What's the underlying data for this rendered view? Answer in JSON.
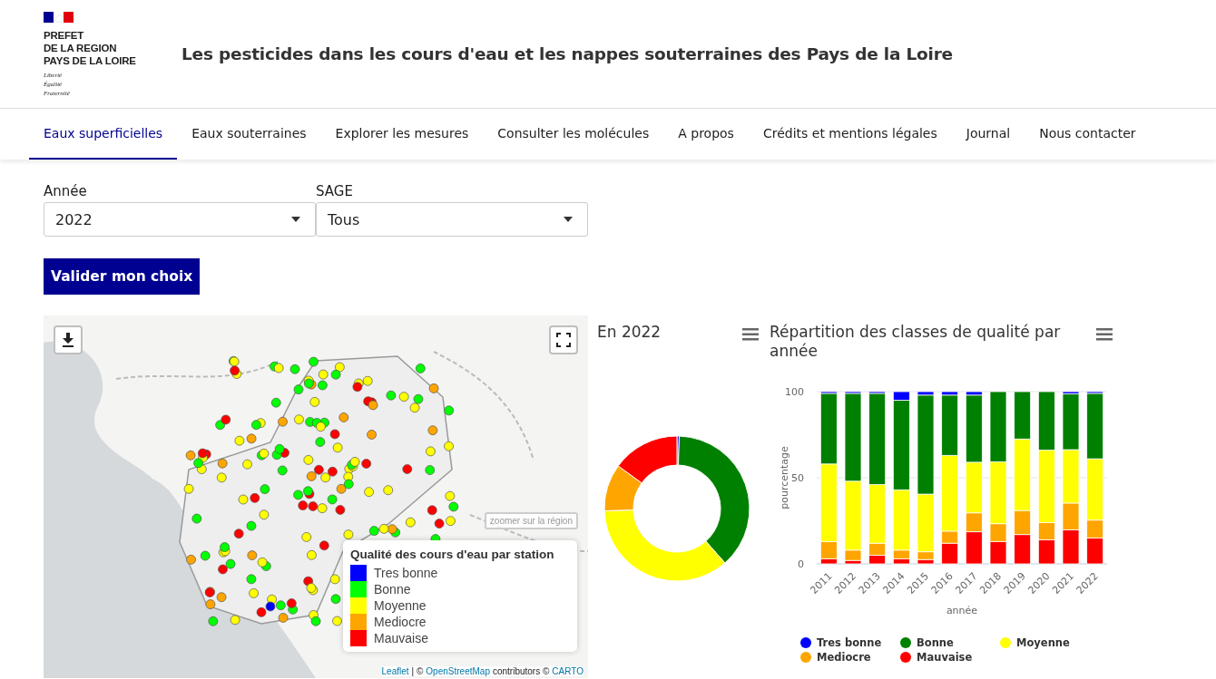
{
  "header": {
    "logo_lines": [
      "PREFET",
      "DE LA REGION",
      "PAYS DE LA LOIRE"
    ],
    "motto": [
      "Liberté",
      "Égalité",
      "Fraternité"
    ],
    "title": "Les pesticides dans les cours d'eau et les nappes souterraines des Pays de la Loire"
  },
  "nav": [
    {
      "label": "Eaux superficielles",
      "selected": true
    },
    {
      "label": "Eaux souterraines",
      "selected": false
    },
    {
      "label": "Explorer les mesures",
      "selected": false
    },
    {
      "label": "Consulter les molécules",
      "selected": false
    },
    {
      "label": "A propos",
      "selected": false
    },
    {
      "label": "Crédits et mentions légales",
      "selected": false
    },
    {
      "label": "Journal",
      "selected": false
    },
    {
      "label": "Nous contacter",
      "selected": false
    }
  ],
  "filters": [
    {
      "label": "Année",
      "value": "2022"
    },
    {
      "label": "SAGE",
      "value": "Tous"
    }
  ],
  "submit": "Valider mon choix",
  "map": {
    "zoom_button": "zoomer sur la région",
    "legend": {
      "title": "Qualité des cours d'eau par station",
      "items": [
        {
          "label": "Tres bonne",
          "color": "#0000ff"
        },
        {
          "label": "Bonne",
          "color": "#00ff00"
        },
        {
          "label": "Moyenne",
          "color": "#ffff00"
        },
        {
          "label": "Mediocre",
          "color": "#ffa500"
        },
        {
          "label": "Mauvaise",
          "color": "#ff0000"
        }
      ]
    },
    "attribution": {
      "link1": "Leaflet",
      "sep": "| ©",
      "link2": "OpenStreetMap",
      "mid": "contributors ©",
      "link3": "CARTO"
    }
  },
  "donut": {
    "title": "En 2022"
  },
  "bars": {
    "chart_data": {
      "type": "bar",
      "stacked": true,
      "title": "Répartition des classes de qualité par année",
      "xlabel": "année",
      "ylabel": "pourcentage",
      "categories": [
        "2011",
        "2012",
        "2013",
        "2014",
        "2015",
        "2016",
        "2017",
        "2018",
        "2019",
        "2020",
        "2021",
        "2022"
      ],
      "yticks": [
        0,
        50,
        100
      ],
      "ylim": [
        0,
        100
      ],
      "series": [
        {
          "name": "Mauvaise",
          "color": "#ff0000",
          "values": [
            3,
            2,
            5,
            3,
            2.5,
            12,
            18.6,
            13,
            17,
            14,
            19.7,
            15
          ]
        },
        {
          "name": "Mediocre",
          "color": "#ffa500",
          "values": [
            10,
            6,
            7,
            5,
            4.5,
            7,
            11,
            10.3,
            14,
            10,
            15.6,
            10.4
          ]
        },
        {
          "name": "Moyenne",
          "color": "#ffff00",
          "values": [
            45,
            40,
            34,
            35,
            33.5,
            44,
            29.4,
            36,
            41.5,
            42,
            31,
            35.6
          ]
        },
        {
          "name": "Bonne",
          "color": "#008000",
          "values": [
            41,
            51,
            53,
            52,
            57.5,
            35,
            39,
            40.7,
            27.5,
            34,
            32.5,
            38
          ]
        },
        {
          "name": "Tres bonne",
          "color": "#0000ff",
          "values": [
            1,
            1,
            1,
            5,
            2,
            2,
            2,
            0,
            0,
            0,
            1.2,
            1
          ]
        }
      ]
    }
  }
}
